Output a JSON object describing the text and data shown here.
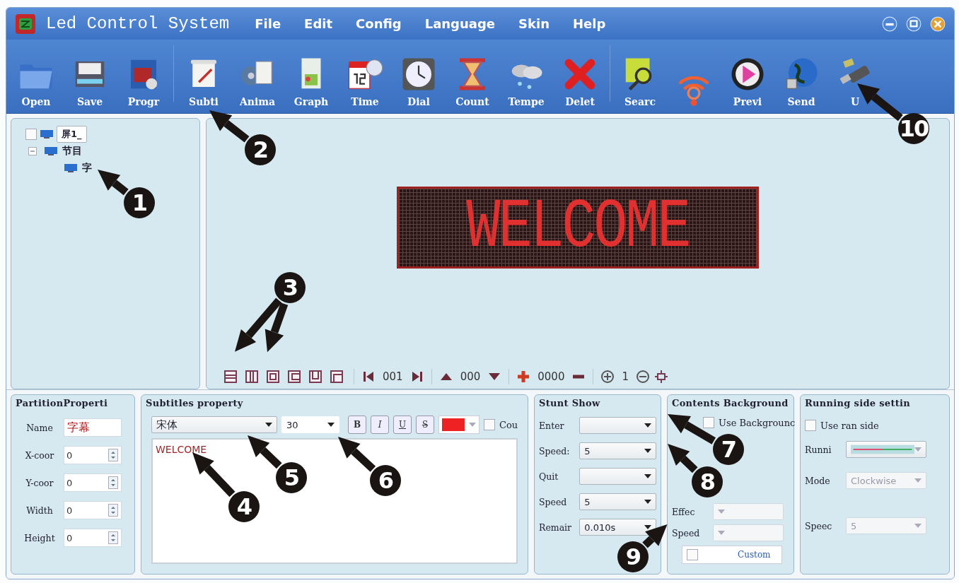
{
  "window": {
    "title": "Led Control System"
  },
  "menu": [
    {
      "label": "File"
    },
    {
      "label": "Edit"
    },
    {
      "label": "Config"
    },
    {
      "label": "Language"
    },
    {
      "label": "Skin"
    },
    {
      "label": "Help"
    }
  ],
  "toolbar": [
    {
      "label": "Open",
      "kind": "folder"
    },
    {
      "label": "Save",
      "kind": "disk"
    },
    {
      "label": "Progr",
      "kind": "film"
    },
    {
      "label": "Subti",
      "kind": "scroll"
    },
    {
      "label": "Anima",
      "kind": "reel"
    },
    {
      "label": "Graph",
      "kind": "document"
    },
    {
      "label": "Time",
      "kind": "calendar"
    },
    {
      "label": "Dial",
      "kind": "clock"
    },
    {
      "label": "Count",
      "kind": "hourglass"
    },
    {
      "label": "Tempe",
      "kind": "cloud"
    },
    {
      "label": "Delet",
      "kind": "cross"
    },
    {
      "label": "Searc",
      "kind": "monitor"
    },
    {
      "kind": "wifi"
    },
    {
      "label": "Previ",
      "kind": "play"
    },
    {
      "label": "Send",
      "kind": "globe"
    },
    {
      "label": "U",
      "kind": "usb"
    }
  ],
  "tree": [
    {
      "label": "屏1_",
      "checked": false,
      "selected": true,
      "children": [
        {
          "label": "节目",
          "selected": false,
          "expanded": true,
          "children": [
            {
              "label": "字",
              "selected": false
            }
          ]
        }
      ]
    }
  ],
  "preview": {
    "text": "WELCOME"
  },
  "canvas_toolbar": {
    "page": "001",
    "layer": "000",
    "value": "0000",
    "zoom": "1"
  },
  "partition": {
    "title": "PartitionProperti",
    "fields": [
      {
        "label": "Name",
        "value": "字幕",
        "kind": "text"
      },
      {
        "label": "X-coor",
        "value": "0",
        "kind": "spin"
      },
      {
        "label": "Y-coor",
        "value": "0",
        "kind": "spin"
      },
      {
        "label": "Width",
        "value": "0",
        "kind": "spin"
      },
      {
        "label": "Height",
        "value": "0",
        "kind": "spin"
      }
    ]
  },
  "subtitles": {
    "title": "Subtitles property",
    "font": "宋体",
    "size": "30",
    "styles": [
      {
        "label": "B"
      },
      {
        "label": "I"
      },
      {
        "label": "U"
      },
      {
        "label": "S"
      }
    ],
    "checkbox": {
      "label": "Cou",
      "checked": false
    },
    "text": "WELCOME"
  },
  "stunt": {
    "title": "Stunt Show",
    "fields": [
      {
        "label": "Enter",
        "disabled": false
      },
      {
        "label": "Speed:",
        "value": "5",
        "disabled": false
      },
      {
        "label": "Quit",
        "disabled": false
      },
      {
        "label": "Speed",
        "value": "5",
        "disabled": false
      },
      {
        "label": "Remair",
        "value": "0.010s",
        "disabled": false
      }
    ]
  },
  "background": {
    "title": "Contents Background",
    "checkbox": {
      "label": "Use Backgrounc",
      "checked": false
    },
    "fields": [
      {
        "label": "Effec",
        "disabled": true
      },
      {
        "label": "Speed",
        "disabled": true
      }
    ],
    "custom": {
      "label": "Custom",
      "checked": false
    }
  },
  "running": {
    "title": "Running side settin",
    "checkbox": {
      "label": "Use ran side",
      "checked": false
    },
    "fields": [
      {
        "label": "Runni",
        "kind": "line",
        "disabled": false
      },
      {
        "label": "Mode",
        "value": "Clockwise",
        "kind": "select",
        "disabled": true
      },
      {
        "label": "Speec",
        "value": "5",
        "kind": "select",
        "disabled": true
      }
    ]
  },
  "callouts": [
    {
      "number": "1"
    },
    {
      "number": "2"
    },
    {
      "number": "3"
    },
    {
      "number": "4"
    },
    {
      "number": "5"
    },
    {
      "number": "6"
    },
    {
      "number": "7"
    },
    {
      "number": "8"
    },
    {
      "number": "9"
    },
    {
      "number": "10"
    }
  ]
}
